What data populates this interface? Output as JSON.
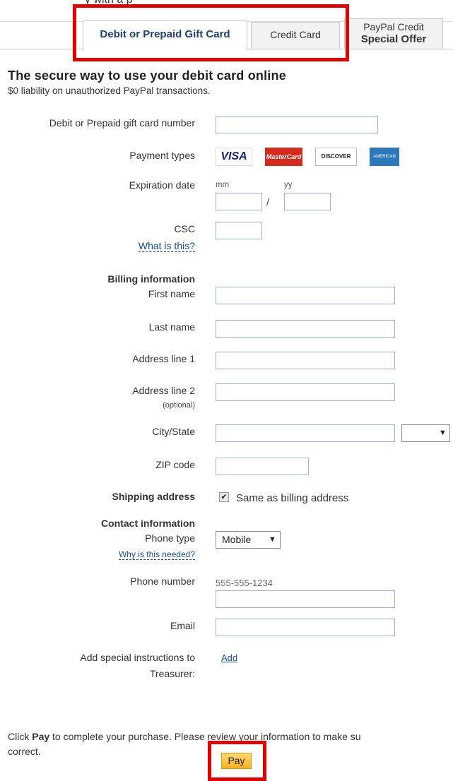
{
  "top_fragment": "y with a p",
  "tabs": {
    "debit": "Debit or Prepaid Gift Card",
    "credit": "Credit Card",
    "paypal_credit_line1": "PayPal Credit",
    "paypal_credit_line2": "Special Offer"
  },
  "heading": "The secure way to use your debit card online",
  "subheading": "$0 liability on unauthorized PayPal transactions.",
  "form": {
    "card_number_label": "Debit or Prepaid gift card number",
    "payment_types_label": "Payment types",
    "cards": [
      "VISA",
      "MasterCard",
      "DISCOVER",
      "AMERICAN EXPRESS"
    ],
    "expiration_label": "Expiration date",
    "mm": "mm",
    "yy": "yy",
    "slash": "/",
    "csc_label": "CSC",
    "csc_help": "What is this?",
    "billing_heading": "Billing information",
    "first_name": "First name",
    "last_name": "Last name",
    "address1": "Address line 1",
    "address2": "Address line 2",
    "optional": "(optional)",
    "city_state": "City/State",
    "zip": "ZIP code",
    "shipping_heading": "Shipping address",
    "same_as_billing": "Same as billing address",
    "contact_heading": "Contact information",
    "phone_type_label": "Phone type",
    "phone_type_value": "Mobile",
    "why_needed": "Why is this needed?",
    "phone_number_label": "Phone number",
    "phone_hint": "555-555-1234",
    "email_label": "Email",
    "special_instr_line1": "Add special instructions to",
    "special_instr_line2": "Treasurer:",
    "add_link": "Add"
  },
  "footer": {
    "pre": "Click ",
    "pay_word": "Pay",
    "post": " to complete your purchase. Please review your information to make su",
    "line2": "correct."
  },
  "pay_button": "Pay",
  "icons": {
    "dropdown": "▼",
    "check": "✔"
  },
  "colors": {
    "highlight": "#e00000",
    "link": "#1a4c8f",
    "pay_button": "#f7b21b"
  }
}
